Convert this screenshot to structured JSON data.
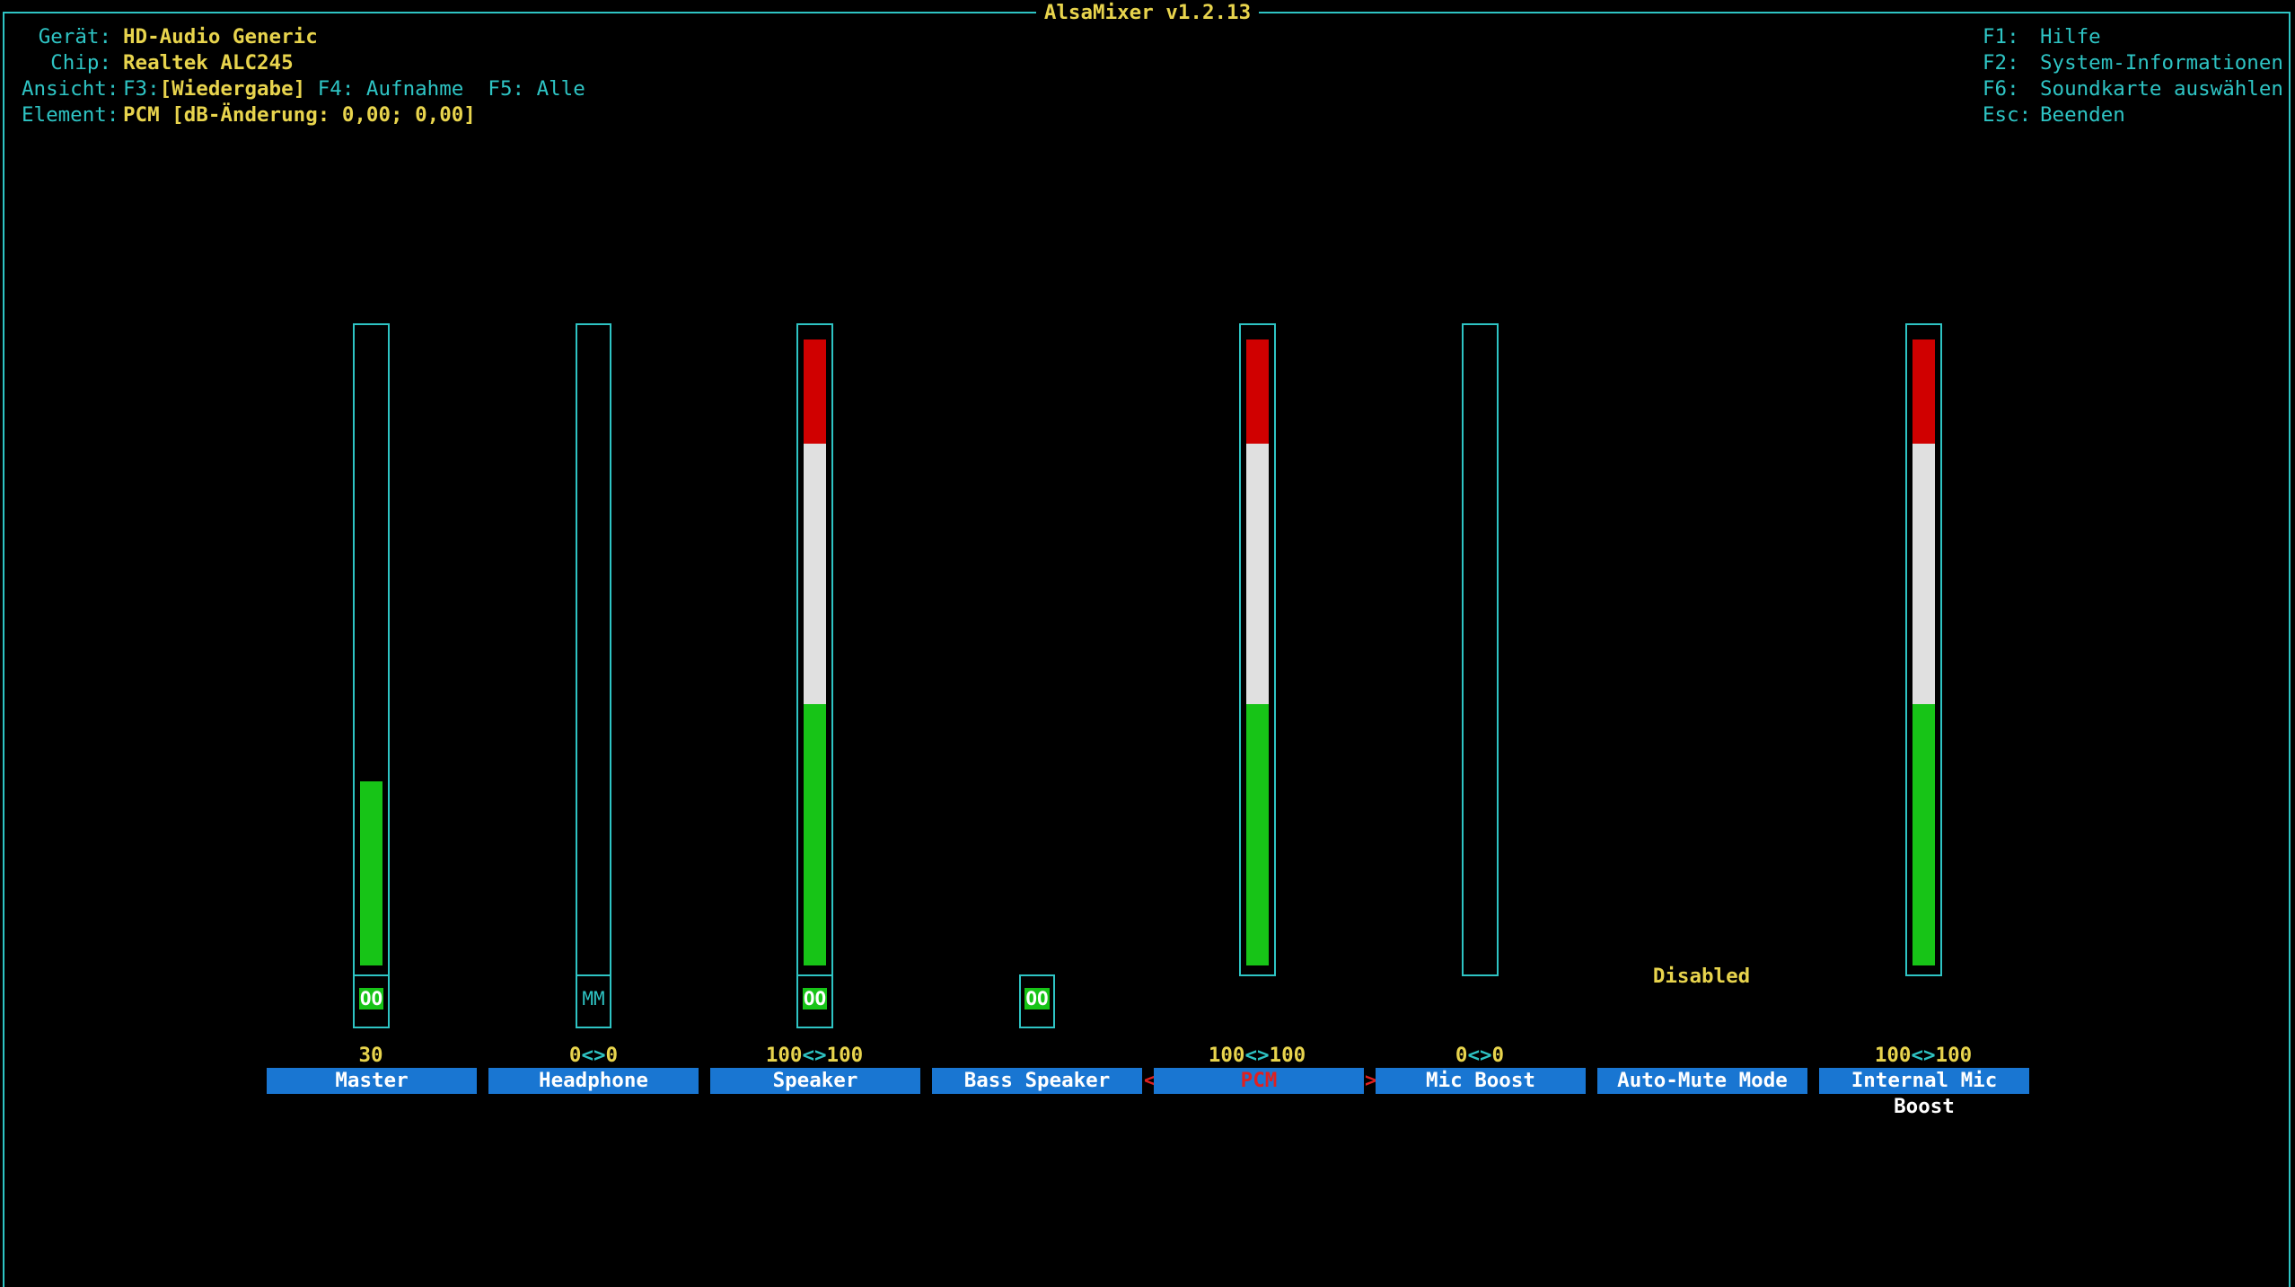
{
  "app": {
    "title": "AlsaMixer v1.2.13"
  },
  "info": {
    "device_label": "Gerät:",
    "device_value": "HD-Audio Generic",
    "chip_label": "Chip:",
    "chip_value": "Realtek ALC245",
    "view_label": "Ansicht:",
    "view_f3_key": "F3:",
    "view_f3_value": "[Wiedergabe]",
    "view_f4": "F4: Aufnahme",
    "view_f5": "F5: Alle",
    "element_label": "Element:",
    "element_value": "PCM [dB-Änderung: 0,00; 0,00]"
  },
  "keys": [
    {
      "key": "F1:",
      "action": "Hilfe"
    },
    {
      "key": "F2:",
      "action": "System-Informationen"
    },
    {
      "key": "F6:",
      "action": "Soundkarte auswählen"
    },
    {
      "key": "Esc:",
      "action": "Beenden"
    }
  ],
  "controls": [
    {
      "name": "Master",
      "level": 0.3,
      "switch": "OO",
      "value_left": "30",
      "value_sep": "",
      "value_right": "",
      "selected": false
    },
    {
      "name": "Headphone",
      "level": 0,
      "switch": "MM",
      "value_left": "0",
      "value_sep": "<>",
      "value_right": "0",
      "selected": false
    },
    {
      "name": "Speaker",
      "level": 1.0,
      "switch": "OO",
      "value_left": "100",
      "value_sep": "<>",
      "value_right": "100",
      "selected": false
    },
    {
      "name": "Bass Speaker",
      "level": null,
      "switch": "OO",
      "value_left": "",
      "value_sep": "",
      "value_right": "",
      "selected": false
    },
    {
      "name": "PCM",
      "level": 1.0,
      "switch": "",
      "value_left": "100",
      "value_sep": "<>",
      "value_right": "100",
      "selected": true
    },
    {
      "name": "Mic Boost",
      "level": 0,
      "switch": "",
      "value_left": "0",
      "value_sep": "<>",
      "value_right": "0",
      "selected": false
    },
    {
      "name": "Auto-Mute Mode",
      "level": null,
      "switch": "",
      "value_left": "",
      "value_sep": "",
      "value_right": "",
      "selected": false,
      "enum_value": "Disabled"
    },
    {
      "name": "Internal Mic Boost",
      "level": 1.0,
      "switch": "",
      "value_left": "100",
      "value_sep": "<>",
      "value_right": "100",
      "selected": false
    }
  ],
  "selection_markers": {
    "left": "<",
    "right": ">"
  },
  "colors": {
    "frame": "#2ec4c4",
    "value_text": "#e8d44d",
    "name_bg": "#1976d2",
    "level_green": "#17c417",
    "level_white": "#e0e0e0",
    "level_red": "#d00000",
    "selected_text": "#e02020"
  }
}
